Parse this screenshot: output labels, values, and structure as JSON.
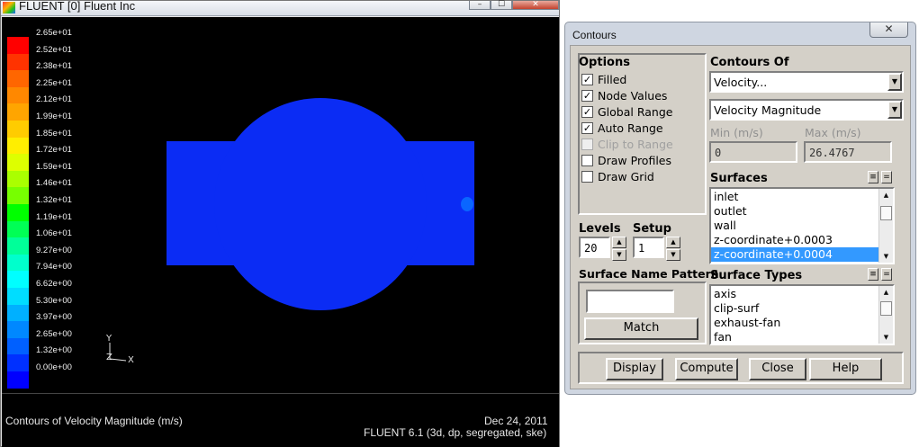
{
  "graphics_window": {
    "title": "FLUENT [0] Fluent Inc",
    "caption": "Contours of Velocity Magnitude (m/s)",
    "date": "Dec 24, 2011",
    "version": "FLUENT 6.1 (3d, dp, segregated, ske)",
    "axis_y": "Y",
    "axis_z": "Z",
    "axis_x": "X",
    "colormap": {
      "labels": [
        "2.65e+01",
        "2.52e+01",
        "2.38e+01",
        "2.25e+01",
        "2.12e+01",
        "1.99e+01",
        "1.85e+01",
        "1.72e+01",
        "1.59e+01",
        "1.46e+01",
        "1.32e+01",
        "1.19e+01",
        "1.06e+01",
        "9.27e+00",
        "7.94e+00",
        "6.62e+00",
        "5.30e+00",
        "3.97e+00",
        "2.65e+00",
        "1.32e+00",
        "0.00e+00"
      ],
      "colors": [
        "#ff0000",
        "#ff3300",
        "#ff6600",
        "#ff8800",
        "#ffa500",
        "#ffcc00",
        "#ffee00",
        "#ddff00",
        "#aaff00",
        "#77ff00",
        "#00ff00",
        "#00ff55",
        "#00ff99",
        "#00ffcc",
        "#00ffff",
        "#00ddff",
        "#00b0ff",
        "#0088ff",
        "#0060ff",
        "#0030ff",
        "#0000ff"
      ]
    },
    "field_color": "#0b2cf4",
    "spot_color": "#0a66ff"
  },
  "dialog": {
    "title": "Contours",
    "close_glyph": "✕",
    "options_header": "Options",
    "options": [
      {
        "label": "Filled",
        "checked": true,
        "disabled": false
      },
      {
        "label": "Node Values",
        "checked": true,
        "disabled": false
      },
      {
        "label": "Global Range",
        "checked": true,
        "disabled": false
      },
      {
        "label": "Auto Range",
        "checked": true,
        "disabled": false
      },
      {
        "label": "Clip to Range",
        "checked": false,
        "disabled": true
      },
      {
        "label": "Draw Profiles",
        "checked": false,
        "disabled": false
      },
      {
        "label": "Draw Grid",
        "checked": false,
        "disabled": false
      }
    ],
    "levels_label": "Levels",
    "levels_value": "20",
    "setup_label": "Setup",
    "setup_value": "1",
    "surface_name_pattern_label": "Surface Name Pattern",
    "surface_name_pattern_value": "",
    "match_button": "Match",
    "contours_of_header": "Contours Of",
    "contours_of_value": "Velocity...",
    "contours_of_sub": "Velocity Magnitude",
    "min_label": "Min (m/s)",
    "min_value": "0",
    "max_label": "Max (m/s)",
    "max_value": "26.4767",
    "surfaces_header": "Surfaces",
    "surfaces": [
      {
        "label": "inlet",
        "selected": false
      },
      {
        "label": "outlet",
        "selected": false
      },
      {
        "label": "wall",
        "selected": false
      },
      {
        "label": "z-coordinate+0.0003",
        "selected": false
      },
      {
        "label": "z-coordinate+0.0004",
        "selected": true
      }
    ],
    "surface_types_header": "Surface Types",
    "surface_types": [
      {
        "label": "axis"
      },
      {
        "label": "clip-surf"
      },
      {
        "label": "exhaust-fan"
      },
      {
        "label": "fan"
      }
    ],
    "buttons": {
      "display": "Display",
      "compute": "Compute",
      "close": "Close",
      "help": "Help"
    }
  }
}
